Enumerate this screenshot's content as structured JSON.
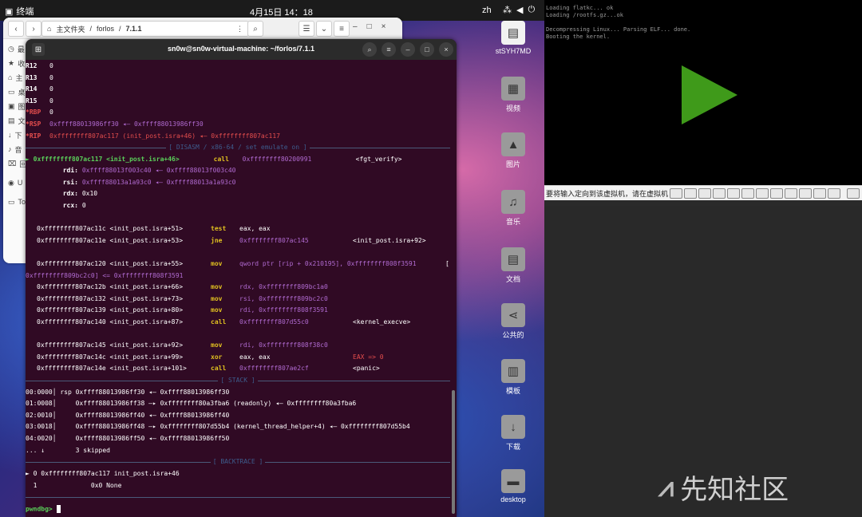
{
  "topbar": {
    "app": "终端",
    "clock": "4月15日 14：18",
    "ime": "zh"
  },
  "desktop_icons": [
    {
      "label": "stSYH7MD",
      "icon": "document-icon"
    },
    {
      "label": "视频",
      "icon": "video-folder-icon"
    },
    {
      "label": "图片",
      "icon": "image-folder-icon"
    },
    {
      "label": "音乐",
      "icon": "music-folder-icon"
    },
    {
      "label": "文档",
      "icon": "doc-folder-icon"
    },
    {
      "label": "公共的",
      "icon": "share-folder-icon"
    },
    {
      "label": "模板",
      "icon": "template-folder-icon"
    },
    {
      "label": "下载",
      "icon": "download-folder-icon"
    },
    {
      "label": "desktop",
      "icon": "folder-icon"
    }
  ],
  "file_manager": {
    "path": [
      "主文件夹",
      "/",
      "forlos",
      "/",
      "7.1.1"
    ],
    "sidebar": [
      "最",
      "收",
      "主",
      "桌",
      "图",
      "文",
      "下",
      "音",
      "回",
      "U",
      "To"
    ]
  },
  "terminal": {
    "title": "sn0w@sn0w-virtual-machine: ~/forlos/7.1.1",
    "regs": [
      {
        "name": "R12",
        "val": "0"
      },
      {
        "name": "R13",
        "val": "0"
      },
      {
        "name": "R14",
        "val": "0"
      },
      {
        "name": "R15",
        "val": "0"
      }
    ],
    "rbp": {
      "name": "*RBP",
      "val": "0"
    },
    "rsp": {
      "name": "*RSP",
      "val": "0xffff88013986ff30 ◂— 0xffff88013986ff30"
    },
    "rip": {
      "name": "*RIP",
      "val": "0xffffffff807ac117 (init_post.isra+46) ◂— 0xffffffff807ac117"
    },
    "disasm_header": "[ DISASM / x86-64 / set emulate on ]",
    "cur_line": {
      "arrow": "►",
      "addr": "0xffffffff807ac117 <init_post.isra+46>",
      "op": "call",
      "arg": "0xffffffff80200991",
      "sym": "<fgt_verify>"
    },
    "args": [
      {
        "reg": "rdi:",
        "val": "0xffff88013f003c40 ◂— 0xffff88013f003c40"
      },
      {
        "reg": "rsi:",
        "val": "0xffff88013a1a93c0 ◂— 0xffff88013a1a93c0"
      },
      {
        "reg": "rdx:",
        "val": "0x10"
      },
      {
        "reg": "rcx:",
        "val": "0"
      }
    ],
    "asm": [
      {
        "addr": "0xffffffff807ac11c <init_post.isra+51>",
        "op": "test",
        "arg": "eax, eax",
        "sym": ""
      },
      {
        "addr": "0xffffffff807ac11e <init_post.isra+53>",
        "op": "jne",
        "arg": "0xffffffff807ac145",
        "sym": "<init_post.isra+92>"
      },
      {
        "addr": "0xffffffff807ac120 <init_post.isra+55>",
        "op": "mov",
        "arg": "qword ptr [rip + 0x210195], 0xffffffff808f3591",
        "sym": "["
      },
      {
        "addr": "0xffffffff809bc2c0] <= 0xffffffff808f3591",
        "op": "",
        "arg": "",
        "sym": ""
      },
      {
        "addr": "0xffffffff807ac12b <init_post.isra+66>",
        "op": "mov",
        "arg": "rdx, 0xffffffff809bc1a0",
        "sym": ""
      },
      {
        "addr": "0xffffffff807ac132 <init_post.isra+73>",
        "op": "mov",
        "arg": "rsi, 0xffffffff809bc2c0",
        "sym": ""
      },
      {
        "addr": "0xffffffff807ac139 <init_post.isra+80>",
        "op": "mov",
        "arg": "rdi, 0xffffffff808f3591",
        "sym": ""
      },
      {
        "addr": "0xffffffff807ac140 <init_post.isra+87>",
        "op": "call",
        "arg": "0xffffffff807d55c0",
        "sym": "<kernel_execve>"
      },
      {
        "addr": "0xffffffff807ac145 <init_post.isra+92>",
        "op": "mov",
        "arg": "rdi, 0xffffffff808f38c0",
        "sym": ""
      },
      {
        "addr": "0xffffffff807ac14c <init_post.isra+99>",
        "op": "xor",
        "arg": "eax, eax",
        "sym": "EAX => 0"
      },
      {
        "addr": "0xffffffff807ac14e <init_post.isra+101>",
        "op": "call",
        "arg": "0xffffffff807ae2cf",
        "sym": "<panic>"
      }
    ],
    "stack_header": "[ STACK ]",
    "stack": [
      "00:0000│ rsp 0xffff88013986ff30 ◂— 0xffff88013986ff30",
      "01:0008│     0xffff88013986ff38 —▸ 0xffffffff80a3fba6 (readonly) ◂— 0xffffffff80a3fba6",
      "02:0010│     0xffff88013986ff40 ◂— 0xffff88013986ff40",
      "03:0018│     0xffff88013986ff48 —▸ 0xffffffff807d55b4 (kernel_thread_helper+4) ◂— 0xffffffff807d55b4",
      "04:0020│     0xffff88013986ff50 ◂— 0xffff88013986ff50",
      "... ↓        3 skipped"
    ],
    "bt_header": "[ BACKTRACE ]",
    "bt": [
      "► 0 0xffffffff807ac117 init_post.isra+46",
      "  1              0x0 None"
    ],
    "prompt": "pwndbg>"
  },
  "vm": {
    "log": "Loading flatkc... ok\nLoading /rootfs.gz...ok\n\nDecompressing Linux... Parsing ELF... done.\nBooting the kernel.",
    "status": "要将输入定向到该虚拟机，请在虚拟机"
  },
  "watermark": "先知社区"
}
